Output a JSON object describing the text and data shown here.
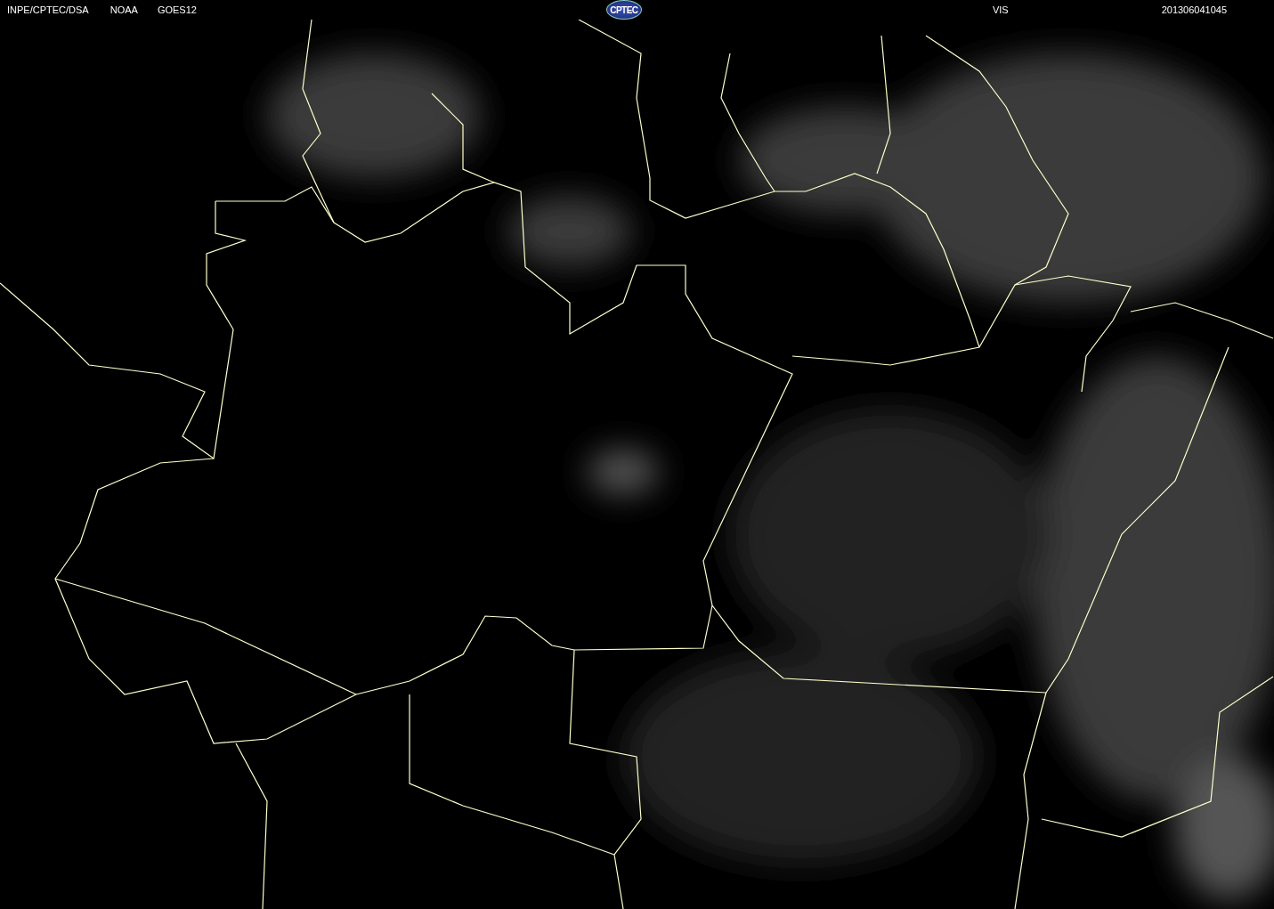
{
  "header": {
    "source": "INPE/CPTEC/DSA",
    "agency": "NOAA",
    "satellite": "GOES12",
    "logo": "CPTEC",
    "channel": "VIS",
    "timestamp": "201306041045"
  }
}
